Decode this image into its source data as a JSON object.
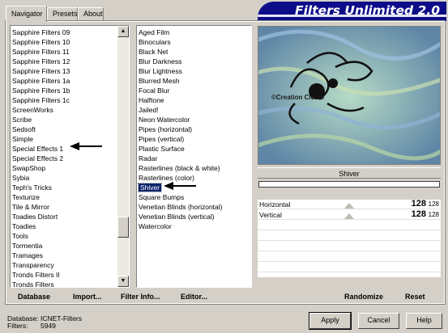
{
  "tabs": [
    {
      "label": "Navigator",
      "active": true
    },
    {
      "label": "Presets",
      "active": false
    },
    {
      "label": "About",
      "active": false
    }
  ],
  "banner": {
    "title": "Filters Unlimited 2.0"
  },
  "categories": {
    "items": [
      "Sapphire Filters 09",
      "Sapphire Filters 10",
      "Sapphire Filters 11",
      "Sapphire Filters 12",
      "Sapphire Filters 13",
      "Sapphire Filters 1a",
      "Sapphire Filters 1b",
      "Sapphire Filters 1c",
      "ScreenWorks",
      "Scribe",
      "Sedsoft",
      "Simple",
      "Special Effects 1",
      "Special Effects 2",
      "SwapShop",
      "Sybia",
      "Teph's Tricks",
      "Texturize",
      "Tile & Mirror",
      "Toadies Distort",
      "Toadies",
      "Tools",
      "Tormentia",
      "Tramages",
      "Transparency",
      "Tronds Filters II",
      "Tronds Filters"
    ],
    "highlighted": "Special Effects 1"
  },
  "filters": {
    "items": [
      "Aged Film",
      "Binoculars",
      "Black Net",
      "Blur Darkness",
      "Blur Lightness",
      "Blurred Mesh",
      "Focal Blur",
      "Halftone",
      "Jailed!",
      "Neon Watercolor",
      "Pipes (horizontal)",
      "Pipes (vertical)",
      "Plastic Surface",
      "Radar",
      "Rasterlines (black & white)",
      "Rasterlines (color)",
      "Shiver",
      "Square Bumps",
      "Venetian Blinds (horizontal)",
      "Venetian Blinds (vertical)",
      "Watercolor"
    ],
    "selected": "Shiver"
  },
  "preview": {
    "watermark": "©Creation Cloclo"
  },
  "current_filter": "Shiver",
  "sliders": [
    {
      "label": "Horizontal",
      "value": "128",
      "max": "128"
    },
    {
      "label": "Vertical",
      "value": "128",
      "max": "128"
    }
  ],
  "toolbar": {
    "database": "Database",
    "import": "Import...",
    "filter_info": "Filter Info...",
    "editor": "Editor...",
    "randomize": "Randomize",
    "reset": "Reset"
  },
  "footer": {
    "database_label": "Database:",
    "database_value": "ICNET-Filters",
    "filters_label": "Filters:",
    "filters_value": "5949"
  },
  "buttons": {
    "apply": "Apply",
    "cancel": "Cancel",
    "help": "Help"
  },
  "colors": {
    "banner": "#0d0d8a",
    "selection": "#0a246a",
    "face": "#d4d0c8"
  }
}
